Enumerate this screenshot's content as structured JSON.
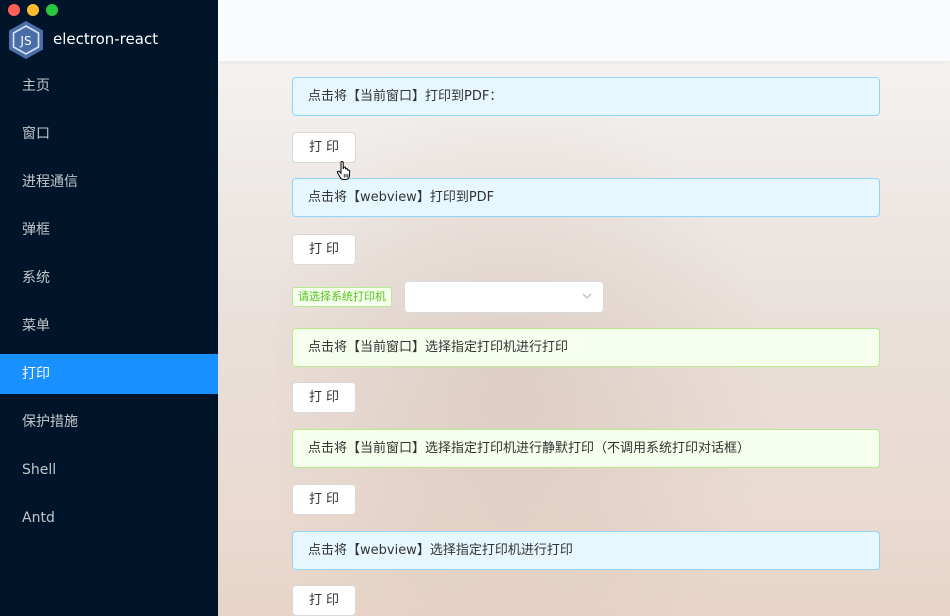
{
  "app": {
    "title": "electron-react"
  },
  "sidebar": {
    "items": [
      {
        "label": "主页"
      },
      {
        "label": "窗口"
      },
      {
        "label": "进程通信"
      },
      {
        "label": "弹框"
      },
      {
        "label": "系统"
      },
      {
        "label": "菜单"
      },
      {
        "label": "打印",
        "active": true
      },
      {
        "label": "保护措施"
      },
      {
        "label": "Shell"
      },
      {
        "label": "Antd"
      }
    ]
  },
  "print": {
    "sections": [
      {
        "alert": "点击将【当前窗口】打印到PDF：",
        "button": "打印"
      },
      {
        "alert": "点击将【webview】打印到PDF",
        "button": "打印"
      },
      {
        "alert": "点击将【当前窗口】选择指定打印机进行打印",
        "button": "打印"
      },
      {
        "alert": "点击将【当前窗口】选择指定打印机进行静默打印（不调用系统打印对话框）",
        "button": "打印"
      },
      {
        "alert": "点击将【webview】选择指定打印机进行打印",
        "button": "打印"
      }
    ],
    "printer_tag": "请选择系统打印机",
    "printer_select_value": ""
  },
  "colors": {
    "sidebar_bg": "#001529",
    "accent": "#1890ff",
    "info_border": "#91d5ff",
    "success_border": "#b7eb8f"
  }
}
